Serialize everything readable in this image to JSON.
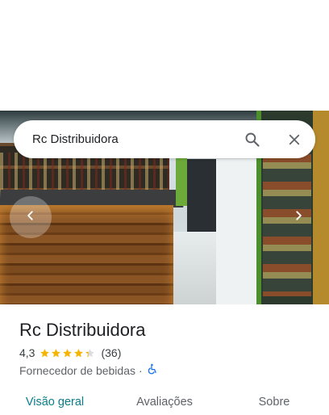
{
  "search": {
    "query": "Rc Distribuidora",
    "search_icon": "search-icon",
    "close_icon": "close-icon"
  },
  "photo_carousel": {
    "prev_icon": "chevron-left-icon",
    "next_icon": "chevron-right-icon"
  },
  "place": {
    "name": "Rc Distribuidora",
    "rating": "4,3",
    "rating_value": 4.3,
    "rating_max": 5,
    "review_count": "(36)",
    "category": "Fornecedor de bebidas",
    "separator": "·",
    "accessibility_icon": "wheelchair-icon"
  },
  "tabs": [
    {
      "label": "Visão geral",
      "active": true
    },
    {
      "label": "Avaliações",
      "active": false
    },
    {
      "label": "Sobre",
      "active": false
    }
  ],
  "colors": {
    "accent": "#0b7e8b",
    "star": "#f4b400",
    "star_empty": "#dadce0",
    "accessibility": "#1a73e8"
  }
}
